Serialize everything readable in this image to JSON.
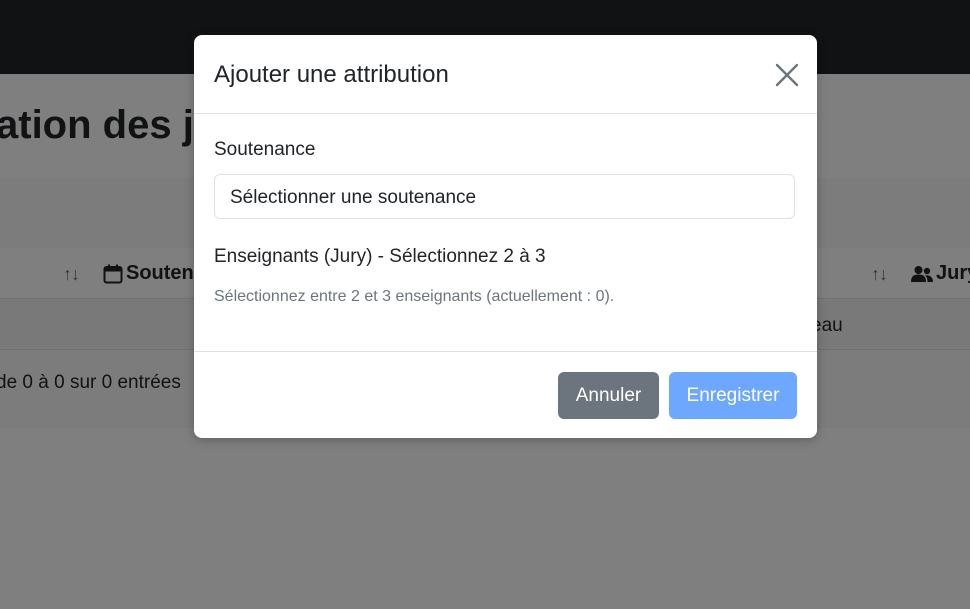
{
  "background": {
    "page_title_fragment": "ation des ju",
    "columns": [
      {
        "label": "Soutena",
        "icon": "calendar-icon"
      },
      {
        "label": "Jury",
        "icon": "users-icon"
      }
    ],
    "sort_glyph": "↑↓",
    "row_fragment": "eau",
    "table_info": "de 0 à 0 sur 0 entrées"
  },
  "modal": {
    "title": "Ajouter une attribution",
    "close_icon": "close-icon",
    "soutenance_label": "Soutenance",
    "soutenance_value": "Sélectionner une soutenance",
    "jury_label": "Enseignants (Jury) - Sélectionnez 2 à 3",
    "jury_help": "Sélectionnez entre 2 et 3 enseignants (actuellement : 0).",
    "cancel_label": "Annuler",
    "save_label": "Enregistrer"
  },
  "colors": {
    "navbar": "#212529",
    "primary_disabled": "#6ea8fe",
    "secondary": "#6c757d"
  }
}
